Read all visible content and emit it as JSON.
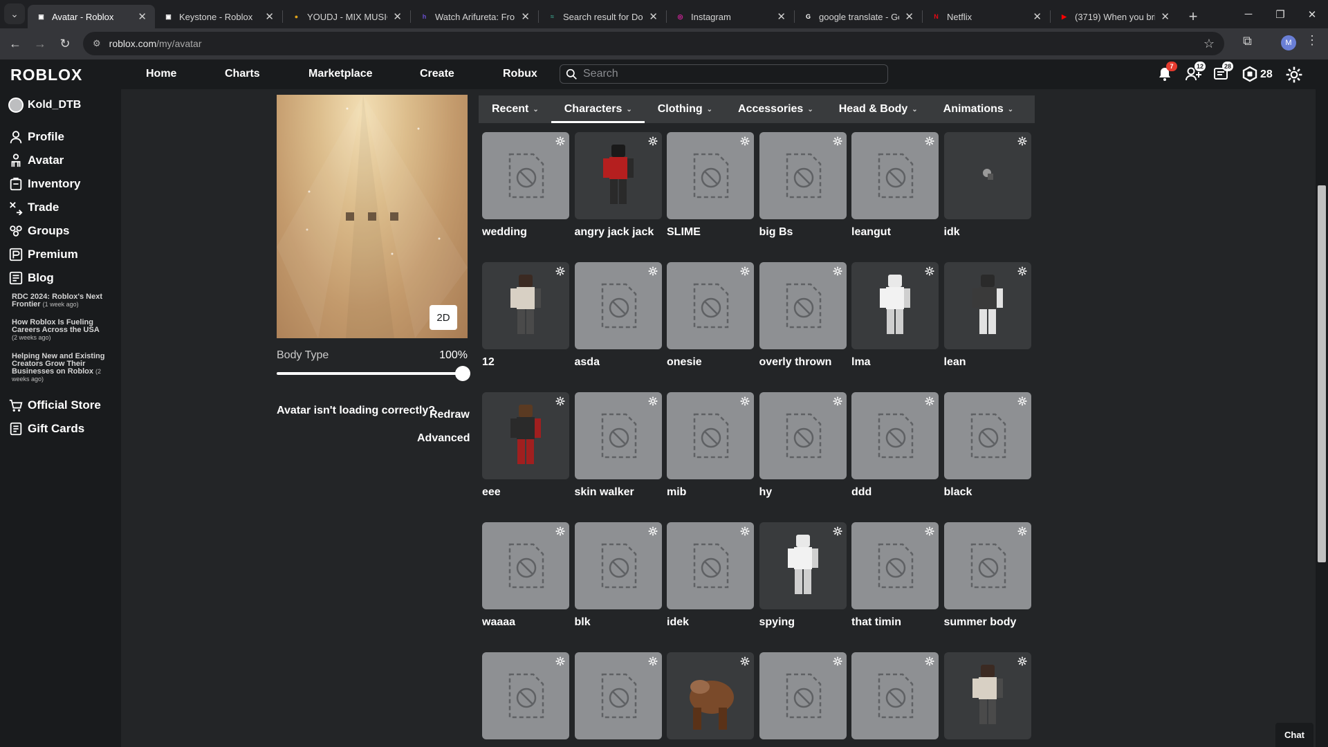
{
  "browser": {
    "tabs": [
      {
        "title": "Avatar - Roblox",
        "active": true,
        "icon": "roblox-icon"
      },
      {
        "title": "Keystone - Roblox",
        "active": false,
        "icon": "roblox-icon"
      },
      {
        "title": "YOUDJ - MIX MUSIC",
        "active": false,
        "icon": "youdj-icon"
      },
      {
        "title": "Watch Arifureta: From",
        "active": false,
        "icon": "hianime-icon"
      },
      {
        "title": "Search result for Dolp",
        "active": false,
        "icon": "site-icon"
      },
      {
        "title": "Instagram",
        "active": false,
        "icon": "instagram-icon"
      },
      {
        "title": "google translate - Go",
        "active": false,
        "icon": "google-icon"
      },
      {
        "title": "Netflix",
        "active": false,
        "icon": "netflix-icon"
      },
      {
        "title": "(3719) When you bri",
        "active": false,
        "icon": "youtube-icon"
      }
    ],
    "url_host": "roblox.com",
    "url_path": "/my/avatar",
    "profile_initial": "M"
  },
  "topbar": {
    "logo": "ROBLOX",
    "nav": [
      "Home",
      "Charts",
      "Marketplace",
      "Create",
      "Robux"
    ],
    "search_placeholder": "Search",
    "notifications_count": "7",
    "friends_count": "12",
    "messages_count": "28",
    "robux_balance": "28"
  },
  "sidebar": {
    "username": "Kold_DTB",
    "items": [
      "Profile",
      "Avatar",
      "Inventory",
      "Trade",
      "Groups",
      "Premium",
      "Blog"
    ],
    "blog_posts": [
      {
        "title": "RDC 2024: Roblox's Next Frontier",
        "age": "(1 week ago)"
      },
      {
        "title": "How Roblox Is Fueling Careers Across the USA",
        "age": "(2 weeks ago)"
      },
      {
        "title": "Helping New and Existing Creators Grow Their Businesses on Roblox",
        "age": "(2 weeks ago)"
      }
    ],
    "bottom_items": [
      "Official Store",
      "Gift Cards"
    ]
  },
  "avatar_panel": {
    "toggle_2d": "2D",
    "body_type_label": "Body Type",
    "body_type_value": "100%",
    "body_type_fraction": 1.0,
    "loading_msg": "Avatar isn't loading correctly?",
    "redraw": "Redraw",
    "advanced": "Advanced"
  },
  "categories": [
    {
      "label": "Recent",
      "active": false
    },
    {
      "label": "Characters",
      "active": true
    },
    {
      "label": "Clothing",
      "active": false
    },
    {
      "label": "Accessories",
      "active": false
    },
    {
      "label": "Head & Body",
      "active": false
    },
    {
      "label": "Animations",
      "active": false
    }
  ],
  "characters": [
    {
      "name": "wedding",
      "thumb": "placeholder"
    },
    {
      "name": "angry jack jack",
      "thumb": "red-figure"
    },
    {
      "name": "SLIME",
      "thumb": "placeholder"
    },
    {
      "name": "big Bs",
      "thumb": "placeholder"
    },
    {
      "name": "leangut",
      "thumb": "placeholder"
    },
    {
      "name": "idk",
      "thumb": "small-figure"
    },
    {
      "name": "12",
      "thumb": "figure"
    },
    {
      "name": "asda",
      "thumb": "placeholder"
    },
    {
      "name": "onesie",
      "thumb": "placeholder"
    },
    {
      "name": "overly thrown",
      "thumb": "placeholder"
    },
    {
      "name": "lma",
      "thumb": "white-figure"
    },
    {
      "name": "lean",
      "thumb": "dark-figure"
    },
    {
      "name": "eee",
      "thumb": "figure-red"
    },
    {
      "name": "skin walker",
      "thumb": "placeholder"
    },
    {
      "name": "mib",
      "thumb": "placeholder"
    },
    {
      "name": "hy",
      "thumb": "placeholder"
    },
    {
      "name": "ddd",
      "thumb": "placeholder"
    },
    {
      "name": "black",
      "thumb": "placeholder"
    },
    {
      "name": "waaaa",
      "thumb": "placeholder"
    },
    {
      "name": "blk",
      "thumb": "placeholder"
    },
    {
      "name": "idek",
      "thumb": "placeholder"
    },
    {
      "name": "spying",
      "thumb": "white-figure"
    },
    {
      "name": "that timin",
      "thumb": "placeholder"
    },
    {
      "name": "summer body",
      "thumb": "placeholder"
    },
    {
      "name": "",
      "thumb": "placeholder"
    },
    {
      "name": "",
      "thumb": "placeholder"
    },
    {
      "name": "",
      "thumb": "brown-creature"
    },
    {
      "name": "",
      "thumb": "placeholder"
    },
    {
      "name": "",
      "thumb": "placeholder"
    },
    {
      "name": "",
      "thumb": "figure"
    }
  ],
  "chat_label": "Chat",
  "colors": {
    "bg": "#232527",
    "topbar": "#191b1d",
    "tile": "#393b3d",
    "placeholder": "#8e9093"
  }
}
